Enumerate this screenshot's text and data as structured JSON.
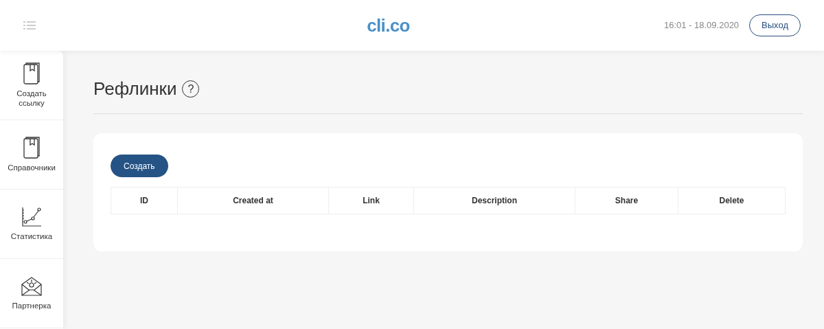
{
  "header": {
    "logo": "cli.co",
    "datetime": "16:01 - 18.09.2020",
    "logout": "Выход"
  },
  "sidebar": {
    "items": [
      {
        "label": "Создать ссылку",
        "kind": "book"
      },
      {
        "label": "Справочники",
        "kind": "book"
      },
      {
        "label": "Статистика",
        "kind": "chart"
      },
      {
        "label": "Партнерка",
        "kind": "envelope"
      }
    ]
  },
  "page": {
    "title": "Рефлинки",
    "help": "?"
  },
  "card": {
    "create_button": "Создать",
    "table": {
      "columns": [
        "ID",
        "Created at",
        "Link",
        "Description",
        "Share",
        "Delete"
      ]
    }
  }
}
